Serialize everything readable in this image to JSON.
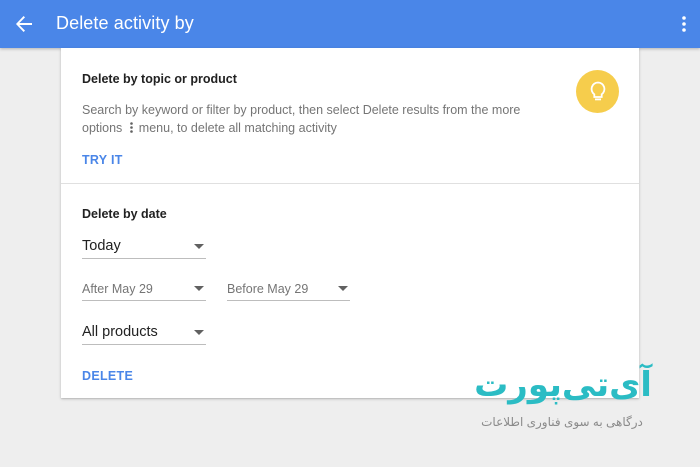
{
  "header": {
    "title": "Delete activity by"
  },
  "topic_section": {
    "heading": "Delete by topic or product",
    "description_part1": "Search by keyword or filter by product, then select Delete results from the more options",
    "description_part2": "menu, to delete all matching activity",
    "try_it_label": "TRY IT"
  },
  "date_section": {
    "heading": "Delete by date",
    "range_select": "Today",
    "after_select": "After May 29",
    "before_select": "Before May 29",
    "product_select": "All products",
    "delete_label": "DELETE"
  },
  "watermark": {
    "logo_text": "آی‌تی‌پورت",
    "tagline": "درگاهی به سوی فناوری اطلاعات"
  },
  "colors": {
    "app_bar": "#4a86e8",
    "accent_link": "#4a86e8",
    "bulb_circle": "#f6cd4c",
    "background": "#eeeeee",
    "watermark": "#2bbcc4"
  },
  "icons": {
    "back": "arrow-left",
    "more": "more-vert",
    "bulb": "lightbulb",
    "inline_more": "more-vert"
  }
}
